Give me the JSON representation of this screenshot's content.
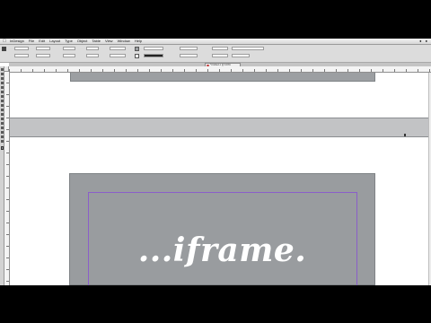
{
  "menubar": {
    "app_name": "InDesign",
    "items": [
      "File",
      "Edit",
      "Layout",
      "Type",
      "Object",
      "Table",
      "View",
      "Window",
      "Help"
    ]
  },
  "document_tab": {
    "label": "*Untitled-1 @ 100%"
  },
  "canvas": {
    "headline": "...iframe."
  },
  "colors": {
    "frame_fill": "#9c9fa2",
    "band_fill": "#c2c3c5",
    "page_fill": "#999c9f",
    "margin_guide": "#8a5fc9",
    "headline": "#ffffff"
  },
  "icons": [
    "apple-icon",
    "selection-tool-icon",
    "close-tab-icon",
    "fill-swatch-icon",
    "stroke-swatch-icon"
  ]
}
